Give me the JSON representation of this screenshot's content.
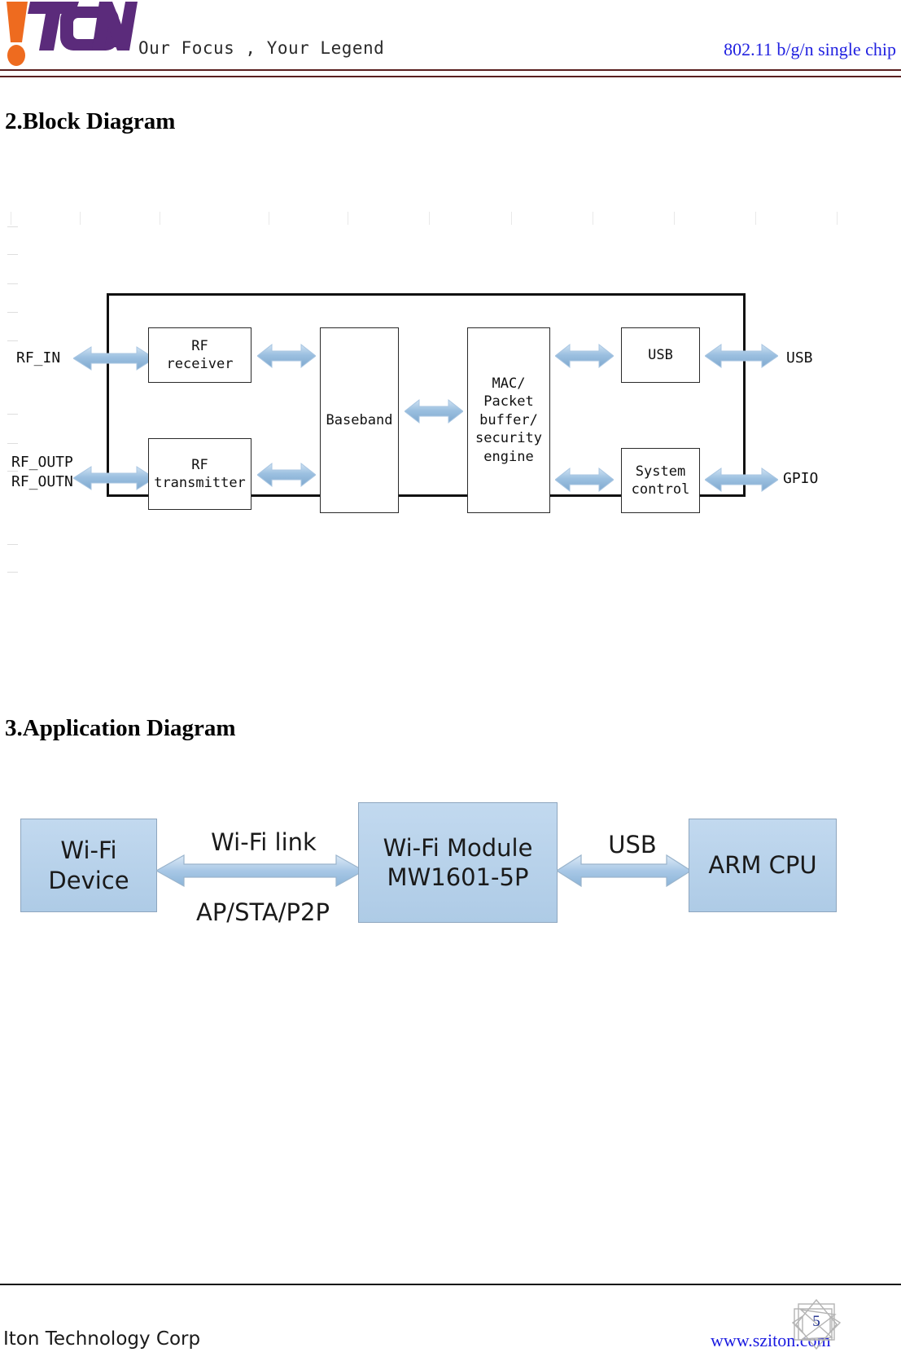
{
  "header": {
    "logo_text": "ITON",
    "logo_colors": {
      "accent": "#EE6B1F",
      "brand": "#5B2B7B"
    },
    "tagline": "Our Focus , Your Legend",
    "right_title": "802.11 b/g/n single chip",
    "right_title_color": "#2020e0",
    "rule_color": "#5a2020"
  },
  "sections": {
    "block": {
      "heading": "2.Block Diagram"
    },
    "app": {
      "heading": "3.Application Diagram"
    }
  },
  "block_diagram": {
    "arrow_color": "#8fb6dc",
    "boxes": [
      {
        "id": "rf-receiver",
        "label": "RF\nreceiver"
      },
      {
        "id": "rf-transmitter",
        "label": "RF\ntransmitter"
      },
      {
        "id": "baseband",
        "label": "Baseband"
      },
      {
        "id": "mac-packet-buffer-security-engine",
        "label": "MAC/\nPacket\nbuffer/\nsecurity\nengine"
      },
      {
        "id": "usb",
        "label": "USB"
      },
      {
        "id": "system-control",
        "label": "System\ncontrol"
      }
    ],
    "pins": [
      {
        "id": "rf-in",
        "label": "RF_IN"
      },
      {
        "id": "rf-outp-outn",
        "label": "RF_OUTP\nRF_OUTN"
      },
      {
        "id": "usb-pin",
        "label": "USB"
      },
      {
        "id": "gpio-pin",
        "label": "GPIO"
      }
    ]
  },
  "app_diagram": {
    "box_fill": "#b8d0e8",
    "box_border": "#8ea6bf",
    "arrow_color": "#9cc0e0",
    "boxes": [
      {
        "id": "wifi-device",
        "line1": "Wi-Fi",
        "line2": "Device"
      },
      {
        "id": "wifi-module",
        "line1": "Wi-Fi  Module",
        "line2": "MW1601-5P"
      },
      {
        "id": "arm-cpu",
        "line1": "ARM CPU",
        "line2": ""
      }
    ],
    "labels": {
      "wifi_link": "Wi-Fi link",
      "ap_sta_p2p": "AP/STA/P2P",
      "usb": "USB"
    }
  },
  "footer": {
    "company": "Iton Technology Corp",
    "website": "www.sziton.com",
    "page_number": "5"
  }
}
